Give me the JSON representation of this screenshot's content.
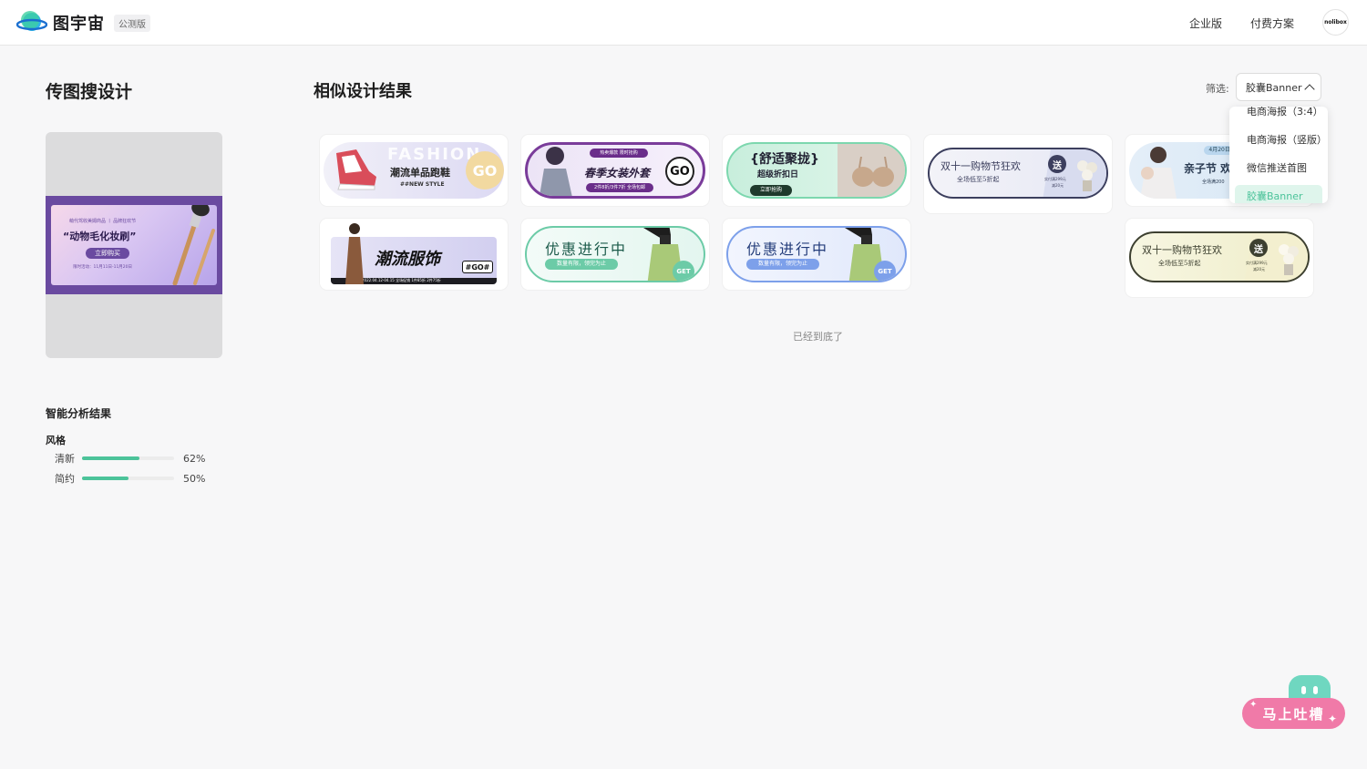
{
  "header": {
    "app_name": "图宇宙",
    "badge": "公测版",
    "nav": [
      "企业版",
      "付费方案"
    ],
    "avatar_text": "nolibox"
  },
  "left": {
    "title": "传图搜设计",
    "query_image": {
      "small_text": "萌代驾收美姆商品 丨 品牌狂欢节",
      "main_text": "“动物毛化妆刷”",
      "button": "立即购买",
      "date": "限时活动：11月11日-11月20日"
    },
    "analysis_title": "智能分析结果",
    "style_label": "风格",
    "styles": [
      {
        "name": "清新",
        "percent": 62,
        "label": "62%"
      },
      {
        "name": "简约",
        "percent": 50,
        "label": "50%"
      }
    ]
  },
  "results": {
    "title": "相似设计结果",
    "filter_label": "筛选:",
    "filter_value": "胶囊Banner",
    "end_text": "已经到底了"
  },
  "dropdown": {
    "options": [
      "电商海报（3:4）",
      "电商海报（竖版）",
      "微信推送首图",
      "胶囊Banner"
    ],
    "selected": "胶囊Banner"
  },
  "cards": [
    {
      "title": "潮流单品跑鞋",
      "sub": "##NEW STYLE",
      "cta": "GO",
      "bg": "FASHION"
    },
    {
      "title": "春季女装外套",
      "top": "热卖爆款 限时抢购",
      "sub": "2件8折/3件7折 全场包邮",
      "cta": "GO"
    },
    {
      "title": "{舒适聚拢}",
      "sub": "超级折扣日",
      "cta": "立即抢购"
    },
    {
      "title": "双十一购物节狂欢",
      "sub": "全场低至5折起",
      "badge": "送",
      "note1": "实付满299元",
      "note2": "减20元"
    },
    {
      "title": "亲子节 欢",
      "top": "4月20日 4月",
      "sub": "全场满200"
    },
    {
      "title": "潮流服饰",
      "cta": "#GO#",
      "date": "2022.04.12-04.15  全场促销 1件85折 2件75折"
    },
    {
      "title": "优惠进行中",
      "sub": "数量有限，领完为止",
      "cta": "GET"
    },
    {
      "title": "优惠进行中",
      "sub": "数量有限，领完为止",
      "cta": "GET"
    },
    {
      "title": "双十一购物节狂欢",
      "sub": "全场低至5折起",
      "badge": "送",
      "note1": "实付满299元",
      "note2": "减20元"
    }
  ],
  "feedback": {
    "label": "马上吐槽"
  },
  "colors": {
    "accent": "#4cc39a",
    "feedback": "#f07aa8",
    "mascot": "#6fd7c0"
  }
}
